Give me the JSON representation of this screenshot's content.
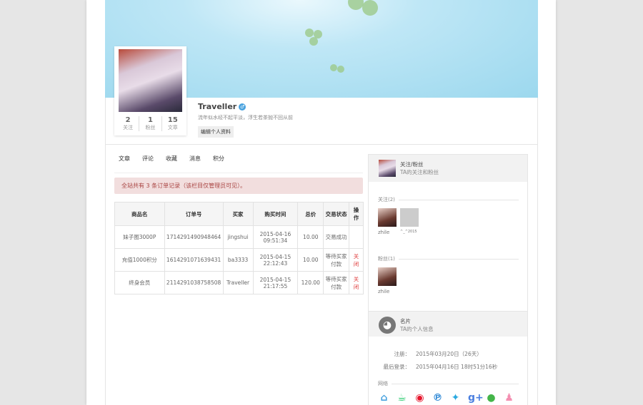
{
  "profile": {
    "name": "Traveller",
    "motto": "流年似水经不起平淡，浮生若茶抛不回从前",
    "edit_label": "编辑个人资料",
    "stats": [
      {
        "value": "2",
        "label": "关注"
      },
      {
        "value": "1",
        "label": "粉丝"
      },
      {
        "value": "15",
        "label": "文章"
      }
    ]
  },
  "tabs": [
    "文章",
    "评论",
    "收藏",
    "消息",
    "积分"
  ],
  "alert": "全站共有 3 条订单记录（该栏目仅管理员可见）。",
  "table": {
    "headers": [
      "商品名",
      "订单号",
      "买家",
      "购买时间",
      "总价",
      "交易状态",
      "操作"
    ],
    "rows": [
      [
        "妹子图3000P",
        "1714291490948464",
        "jingshui",
        "2015-04-16 09:51:34",
        "10.00",
        "交易成功",
        ""
      ],
      [
        "充值1000积分",
        "1614291071639431",
        "ba3333",
        "2015-04-15 22:12:43",
        "10.00",
        "等待买家付款",
        "关闭"
      ],
      [
        "终身会员",
        "2114291038758508",
        "Traveller",
        "2015-04-15 21:17:55",
        "120.00",
        "等待买家付款",
        "关闭"
      ]
    ]
  },
  "follow_panel": {
    "title": "关注/粉丝",
    "subtitle": "TA的关注和粉丝",
    "following_label": "关注(2)",
    "followers_label": "粉丝(1)",
    "following": [
      "zhile",
      "^_^2015"
    ],
    "followers": [
      "zhile"
    ]
  },
  "card_panel": {
    "title": "名片",
    "subtitle": "TA的个人信息",
    "reg_label": "注册：",
    "reg_value": "2015年03月20日（26天）",
    "last_label": "最后登录：",
    "last_value": "2015年04月16日 18时51分16秒",
    "network_label": "网络"
  },
  "social": [
    {
      "icon": "home-icon",
      "glyph": "⌂",
      "color": "#4aa3df"
    },
    {
      "icon": "coffee-icon",
      "glyph": "☕",
      "color": "#2ecc71"
    },
    {
      "icon": "weibo-icon",
      "glyph": "◉",
      "color": "#e6162d"
    },
    {
      "icon": "pinterest-icon",
      "glyph": "℗",
      "color": "#3a8fd8"
    },
    {
      "icon": "twitter-icon",
      "glyph": "✦",
      "color": "#2aa9e0"
    },
    {
      "icon": "google-plus-icon",
      "glyph": "g+",
      "color": "#4a7fe0"
    },
    {
      "icon": "wechat-icon",
      "glyph": "●",
      "color": "#44b549"
    },
    {
      "icon": "qq-icon",
      "glyph": "♟",
      "color": "#f48fb1"
    }
  ]
}
